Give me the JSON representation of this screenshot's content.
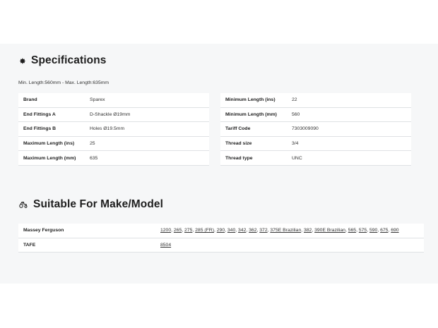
{
  "specifications": {
    "title": "Specifications",
    "icon": "gear-icon",
    "lengths_note": "Min. Length:560mm - Max. Length:635mm",
    "left_rows": [
      {
        "label": "Brand",
        "value": "Sparex"
      },
      {
        "label": "End Fittings A",
        "value": "D-Shackle Ø19mm"
      },
      {
        "label": "End Fittings B",
        "value": "Holes Ø19.5mm"
      },
      {
        "label": "Maximum Length (ins)",
        "value": "25"
      },
      {
        "label": "Maximum Length (mm)",
        "value": "635"
      }
    ],
    "right_rows": [
      {
        "label": "Minimum Length (ins)",
        "value": "22"
      },
      {
        "label": "Minimum Length (mm)",
        "value": "560"
      },
      {
        "label": "Tariff Code",
        "value": "7303009090"
      },
      {
        "label": "Thread size",
        "value": "3/4"
      },
      {
        "label": "Thread type",
        "value": "UNC"
      }
    ]
  },
  "suitable": {
    "title": "Suitable For Make/Model",
    "icon": "tractor-icon",
    "makes": [
      {
        "label": "Massey Ferguson",
        "models": [
          "1200",
          "265",
          "275",
          "285 (FR)",
          "290",
          "340",
          "342",
          "362",
          "372",
          "375E Brazilian",
          "382",
          "390E Brazilian",
          "565",
          "575",
          "590",
          "675",
          "690"
        ]
      },
      {
        "label": "TAFE",
        "models": [
          "8504"
        ]
      }
    ]
  }
}
